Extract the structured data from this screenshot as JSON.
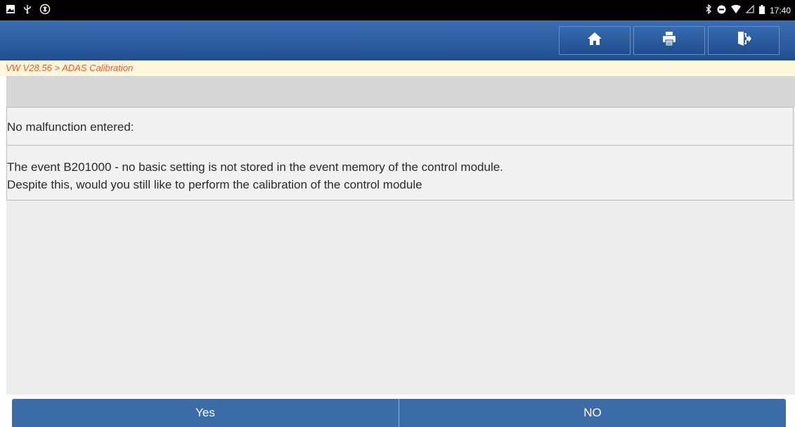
{
  "status_bar": {
    "time": "17:40",
    "icons_left": [
      "image-icon",
      "usb-icon",
      "vci-icon"
    ],
    "icons_right": [
      "bluetooth-icon",
      "do-not-disturb-icon",
      "wifi-icon",
      "signal-icon",
      "battery-icon"
    ]
  },
  "toolbar": {
    "buttons": [
      {
        "name": "home",
        "icon": "home-icon"
      },
      {
        "name": "print",
        "icon": "printer-icon"
      },
      {
        "name": "exit",
        "icon": "exit-icon"
      }
    ],
    "accent_color": "#2d5ea3"
  },
  "breadcrumb": {
    "text": "VW V28.56 > ADAS Calibration",
    "color": "#ef5a2a"
  },
  "message": {
    "title": "No malfunction entered:",
    "line1": "The event B201000 - no basic setting is not stored in the event memory of the control module.",
    "line2": "Despite this, would you still like to perform the calibration of the control module"
  },
  "actions": {
    "yes_label": "Yes",
    "no_label": "NO"
  }
}
